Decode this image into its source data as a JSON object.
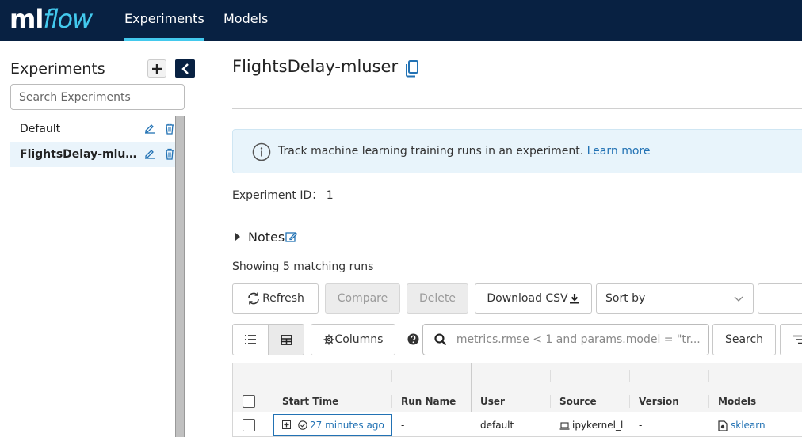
{
  "nav": {
    "logo_ml": "ml",
    "logo_flow": "flow",
    "tabs": [
      {
        "label": "Experiments",
        "active": true
      },
      {
        "label": "Models",
        "active": false
      }
    ]
  },
  "sidebar": {
    "title": "Experiments",
    "search_placeholder": "Search Experiments",
    "items": [
      {
        "label": "Default",
        "active": false
      },
      {
        "label": "FlightsDelay-mluser",
        "active": true
      }
    ]
  },
  "main": {
    "title": "FlightsDelay-mluser",
    "banner": {
      "text": "Track machine learning training runs in an experiment.",
      "link": "Learn more"
    },
    "experiment_id_label": "Experiment ID：",
    "experiment_id": "1",
    "notes_label": "Notes",
    "showing_text": "Showing 5 matching runs",
    "toolbar": {
      "refresh": "Refresh",
      "compare": "Compare",
      "delete": "Delete",
      "download_csv": "Download CSV",
      "sort_by": "Sort by",
      "columns": "Columns",
      "search": "Search",
      "search_placeholder": "metrics.rmse < 1 and params.model = \"tr..."
    },
    "table": {
      "headers": [
        "Start Time",
        "Run Name",
        "User",
        "Source",
        "Version",
        "Models"
      ],
      "rows": [
        {
          "start_time": "27 minutes ago",
          "run_name": "-",
          "user": "default",
          "source": "ipykernel_l",
          "version": "-",
          "models": "sklearn"
        }
      ]
    }
  },
  "colors": {
    "nav_bg": "#082142",
    "accent": "#43c9ed",
    "link": "#2272b4",
    "banner_bg": "#e8f4fb"
  }
}
